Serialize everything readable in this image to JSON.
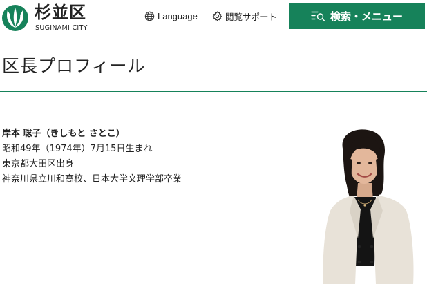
{
  "header": {
    "logo": {
      "name_ja": "杉並区",
      "name_en": "SUGINAMI CITY"
    },
    "language_label": "Language",
    "support_label": "閲覧サポート",
    "menu_button_label": "検索・メニュー",
    "icons": {
      "language": "globe-icon",
      "support": "gear-icon",
      "menu": "search-menu-icon"
    }
  },
  "page": {
    "title": "区長プロフィール"
  },
  "profile": {
    "name": "岸本 聡子（きしもと さとこ）",
    "birth": "昭和49年（1974年）7月15日生まれ",
    "hometown": "東京都大田区出身",
    "education": "神奈川県立川和高校、日本大学文理学部卒業"
  },
  "colors": {
    "brand_green": "#16825a",
    "text": "#222222",
    "background": "#ffffff"
  }
}
